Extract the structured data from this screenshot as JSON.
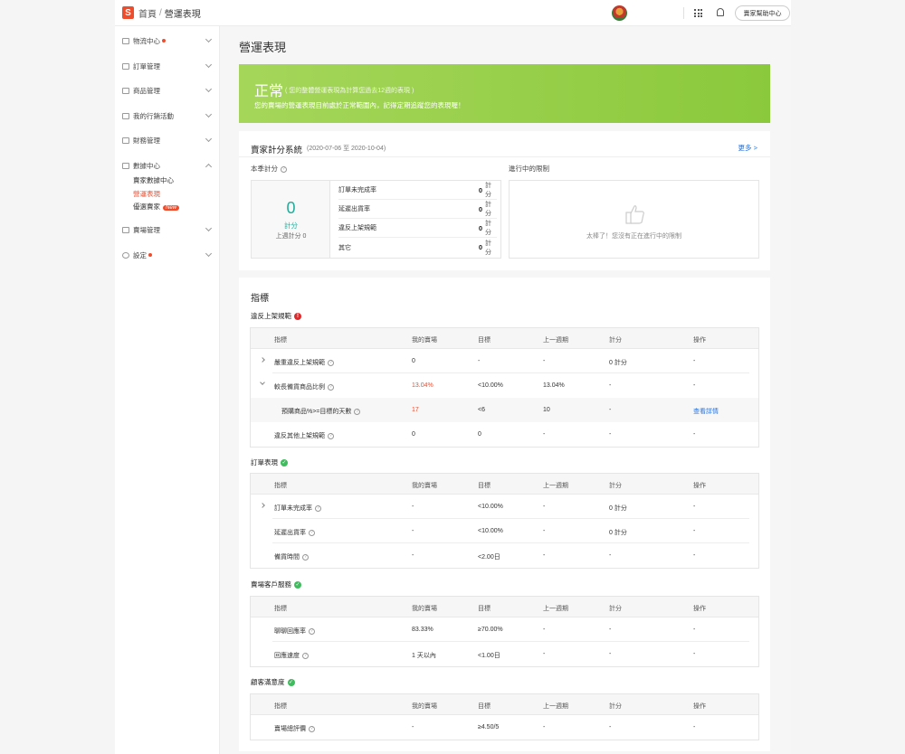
{
  "header": {
    "logo": "S",
    "home": "首頁",
    "separator": "/",
    "current": "營運表現",
    "help_button": "賣家幫助中心"
  },
  "sidebar": {
    "items": [
      {
        "label": "物流中心",
        "dot": true
      },
      {
        "label": "訂單管理"
      },
      {
        "label": "商品管理"
      },
      {
        "label": "我的行銷活動"
      },
      {
        "label": "財務管理"
      },
      {
        "label": "數據中心"
      },
      {
        "label": "賣場管理"
      },
      {
        "label": "設定",
        "dot": true
      }
    ],
    "data_center_sub": [
      "賣家數據中心",
      "營運表現",
      "優選賣家"
    ],
    "new_badge": "New"
  },
  "page": {
    "title": "營運表現"
  },
  "banner": {
    "status": "正常",
    "note": "( 您的整體營運表現為計算您過去12週的表現 )",
    "desc": "您的賣場的營運表現目前處於正常範圍內，記得定期追蹤您的表現喔！",
    "color_start": "#a5d65a",
    "color_end": "#8bc93c"
  },
  "score_card": {
    "title": "賣家計分系統",
    "range": "(2020-07-06 至 2020-10-04)",
    "more": "更多 >",
    "quarter_label": "本季計分",
    "score": "0",
    "score_unit": "計分",
    "prev_week": "上週計分 0",
    "rows": [
      {
        "name": "訂單未完成率",
        "value": "0",
        "unit": "計分"
      },
      {
        "name": "延遲出貨率",
        "value": "0",
        "unit": "計分"
      },
      {
        "name": "違反上架規範",
        "value": "0",
        "unit": "計分"
      },
      {
        "name": "其它",
        "value": "0",
        "unit": "計分"
      }
    ],
    "restrict_label": "進行中的限制",
    "restrict_text": "太棒了！您沒有正在進行中的限制"
  },
  "metrics": {
    "title": "指標",
    "headers": [
      "指標",
      "我的賣場",
      "目標",
      "上一週期",
      "計分",
      "操作"
    ],
    "sections": [
      {
        "title": "違反上架規範",
        "badge": "!",
        "rows": [
          {
            "name": "嚴重違反上架規範",
            "mine": "0",
            "target": "-",
            "prev": "-",
            "score": "0 計分",
            "action": "-",
            "expand": "closed"
          },
          {
            "name": "較長備貨商品比例",
            "mine": "13.04%",
            "target": "<10.00%",
            "prev": "13.04%",
            "score": "-",
            "action": "-",
            "expand": "open",
            "red": true
          },
          {
            "name": "預購商品%>=目標的天數",
            "mine": "17",
            "target": "<6",
            "prev": "10",
            "score": "-",
            "action": "查看詳情",
            "child": true,
            "red": true
          },
          {
            "name": "違反其他上架規範",
            "mine": "0",
            "target": "0",
            "prev": "-",
            "score": "-",
            "action": "-"
          }
        ]
      },
      {
        "title": "訂單表現",
        "badge": "✓",
        "rows": [
          {
            "name": "訂單未完成率",
            "mine": "-",
            "target": "<10.00%",
            "prev": "-",
            "score": "0 計分",
            "action": "-",
            "expand": "closed"
          },
          {
            "name": "延遲出貨率",
            "mine": "-",
            "target": "<10.00%",
            "prev": "-",
            "score": "0 計分",
            "action": "-"
          },
          {
            "name": "備貨時間",
            "mine": "-",
            "target": "<2.00日",
            "prev": "-",
            "score": "-",
            "action": "-"
          }
        ]
      },
      {
        "title": "賣場客戶服務",
        "badge": "✓",
        "rows": [
          {
            "name": "聊聊回應率",
            "mine": "83.33%",
            "target": "≥70.00%",
            "prev": "-",
            "score": "-",
            "action": "-"
          },
          {
            "name": "回應速度",
            "mine": "1 天以內",
            "target": "<1.00日",
            "prev": "-",
            "score": "-",
            "action": "-"
          }
        ]
      },
      {
        "title": "顧客滿意度",
        "badge": "✓",
        "rows": [
          {
            "name": "賣場總評價",
            "mine": "-",
            "target": "≥4.50/5",
            "prev": "-",
            "score": "-",
            "action": "-"
          }
        ]
      }
    ]
  },
  "colors": {
    "brand": "#ee4d2d",
    "score_green": "#26aa99",
    "link_blue": "#2673dd"
  }
}
